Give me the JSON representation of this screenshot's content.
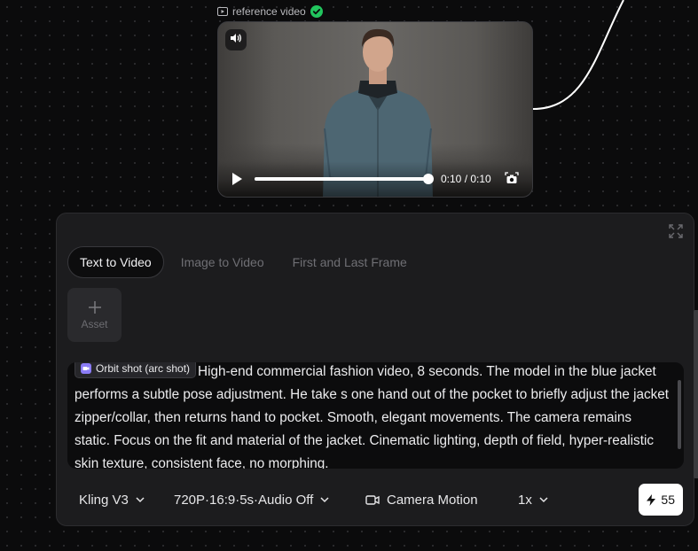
{
  "reference_node": {
    "label": "reference video",
    "status": "ready",
    "time_display": "0:10 / 0:10",
    "progress": 1.0
  },
  "panel": {
    "tabs": [
      {
        "label": "Text to Video",
        "active": true
      },
      {
        "label": "Image to Video",
        "active": false
      },
      {
        "label": "First and Last Frame",
        "active": false
      }
    ],
    "asset_label": "Asset",
    "prompt": {
      "chip_label": "Orbit shot (arc shot)",
      "text": "High-end commercial fashion video, 8 seconds. The model in the blue jacket performs a subtle pose adjustment. He take s one hand out of the pocket to briefly adjust the jacket zipper/collar, then returns hand to pocket. Smooth, elegant movements. The camera remains static. Focus on the fit and material of the jacket. Cinematic lighting, depth of field, hyper-realistic skin texture, consistent face, no morphing."
    },
    "toolbar": {
      "model": "Kling V3",
      "settings": "720P·16:9·5s·Audio Off",
      "camera_motion": "Camera Motion",
      "count": "1x",
      "credits": "55"
    }
  },
  "colors": {
    "background": "#0b0b0c",
    "panel": "#1c1c1e",
    "check_green": "#22c55e",
    "chip_icon": "#8b7cf6",
    "jacket": "#4d6672"
  },
  "icons": [
    "video-icon",
    "check-icon",
    "speaker-icon",
    "play-icon",
    "snapshot-icon",
    "expand-icon",
    "plus-icon",
    "camera-motion-icon",
    "chevron-down-icon",
    "bolt-icon"
  ]
}
